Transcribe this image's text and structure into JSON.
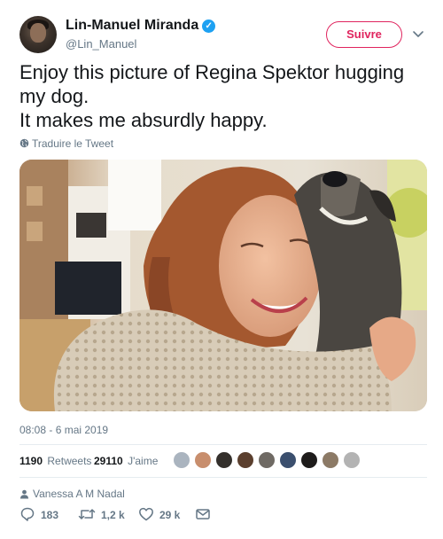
{
  "header": {
    "display_name": "Lin-Manuel Miranda",
    "handle": "@Lin_Manuel",
    "follow_label": "Suivre"
  },
  "tweet": {
    "lines": [
      "Enjoy this picture of Regina Spektor hugging",
      "my dog.",
      "It makes me absurdly happy."
    ],
    "translate_label": "Traduire le Tweet",
    "timestamp": "08:08 - 6 mai 2019"
  },
  "stats": {
    "retweets_count": "1190",
    "retweets_label": "Retweets",
    "likes_count": "29110",
    "likes_label": "J'aime"
  },
  "social_context": {
    "name": "Vanessa A M Nadal"
  },
  "actions": {
    "replies": "183",
    "retweets": "1,2 k",
    "likes": "29 k"
  },
  "colors": {
    "follow_accent": "#e0245e",
    "verified_blue": "#1da1f2",
    "secondary_text": "#657786"
  },
  "icons": [
    "verified-badge-icon",
    "chevron-down-icon",
    "globe-icon",
    "person-icon",
    "reply-icon",
    "retweet-icon",
    "heart-icon",
    "direct-message-icon"
  ]
}
